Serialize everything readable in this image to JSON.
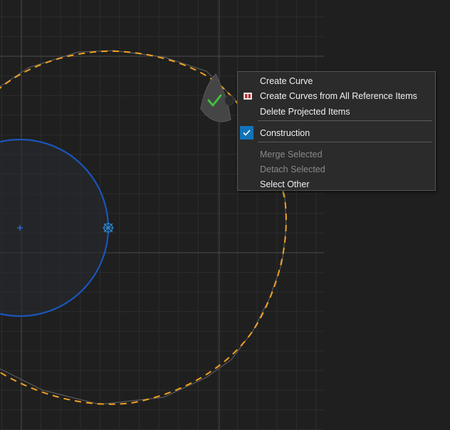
{
  "canvas": {
    "background": "#1f1f1f",
    "grid_color": "#2e2e2e",
    "axis_color": "#4a4a4a",
    "circle_color": "#1a56b8",
    "projected_color": "#f0a020"
  },
  "marking_menu": {
    "ok_icon": "checkmark-icon",
    "ok_color": "#3fbf3f"
  },
  "context_menu": {
    "items": [
      {
        "label": "Create Curve",
        "enabled": true
      },
      {
        "label": "Create Curves from All Reference Items",
        "enabled": true,
        "icon": "reference-items-icon"
      },
      {
        "label": "Delete Projected Items",
        "enabled": true
      },
      {
        "label": "Construction",
        "enabled": true,
        "checked": true
      },
      {
        "label": "Merge Selected",
        "enabled": false
      },
      {
        "label": "Detach Selected",
        "enabled": false
      },
      {
        "label": "Select Other",
        "enabled": true
      }
    ]
  }
}
